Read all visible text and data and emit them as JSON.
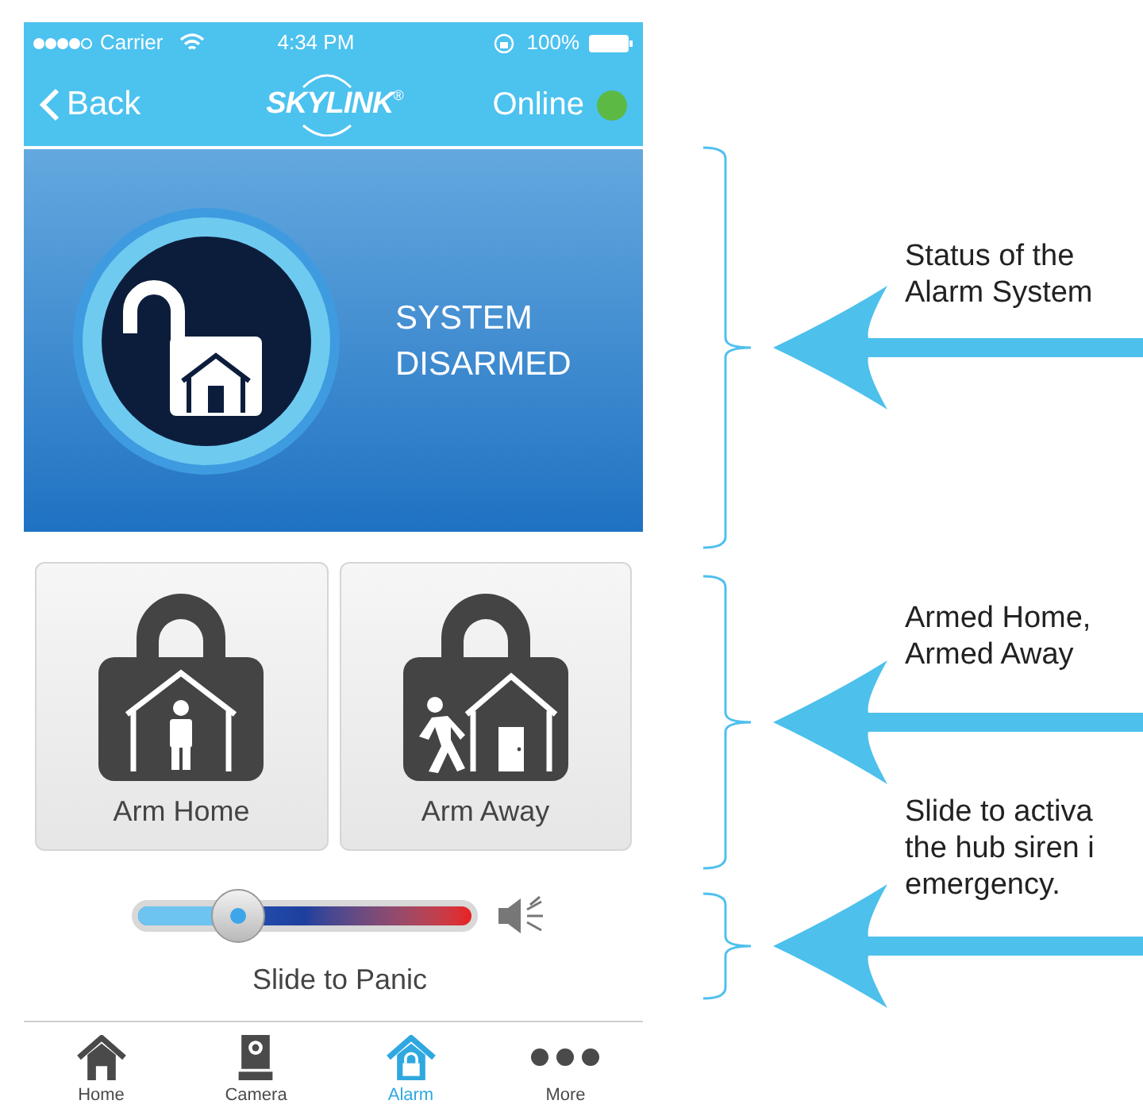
{
  "status_bar": {
    "carrier": "Carrier",
    "time": "4:34 PM",
    "battery": "100%"
  },
  "nav_bar": {
    "back": "Back",
    "logo": "SKYLINK",
    "logo_mark": "®",
    "connection": "Online",
    "online": true
  },
  "alarm_status": {
    "text": "SYSTEM DISARMED",
    "armed": false
  },
  "arm_buttons": [
    {
      "label": "Arm Home",
      "kind": "home"
    },
    {
      "label": "Arm Away",
      "kind": "away"
    }
  ],
  "panic_slider": {
    "level": 0.3,
    "label": "Slide to Panic"
  },
  "tab_bar": [
    {
      "label": "Home",
      "kind": "home",
      "selected": false
    },
    {
      "label": "Camera",
      "kind": "camera",
      "selected": false
    },
    {
      "label": "Alarm",
      "kind": "alarm",
      "selected": true
    },
    {
      "label": "More",
      "kind": "more",
      "selected": false
    }
  ],
  "annotations": [
    {
      "lines": [
        "Status of the",
        "Alarm System"
      ]
    },
    {
      "lines": [
        "Armed Home,",
        "Armed Away"
      ]
    },
    {
      "lines": [
        "Slide to activa",
        "the hub siren i",
        "emergency."
      ]
    }
  ]
}
